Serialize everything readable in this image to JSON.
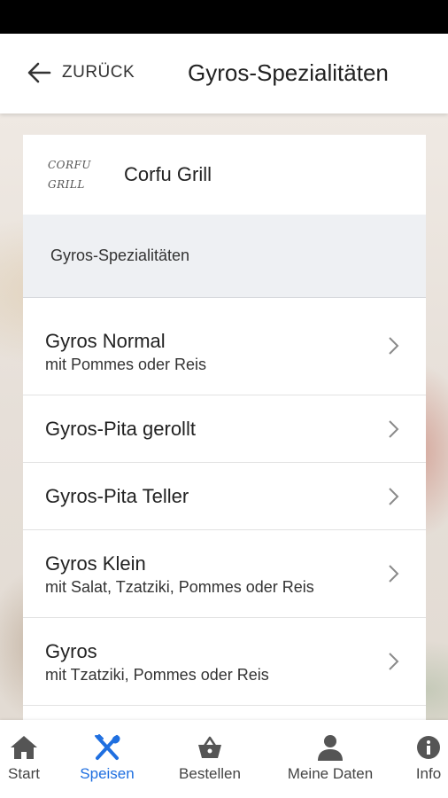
{
  "header": {
    "back_label": "ZURÜCK",
    "title": "Gyros-Spezialitäten"
  },
  "restaurant": {
    "logo_line1": "CORFU",
    "logo_line2": "GRILL",
    "name": "Corfu Grill"
  },
  "category": {
    "label": "Gyros-Spezialitäten"
  },
  "items": [
    {
      "name": "Gyros Normal",
      "sub": "mit Pommes oder Reis"
    },
    {
      "name": "Gyros-Pita gerollt",
      "sub": ""
    },
    {
      "name": "Gyros-Pita Teller",
      "sub": ""
    },
    {
      "name": "Gyros Klein",
      "sub": "mit Salat, Tzatziki, Pommes oder Reis"
    },
    {
      "name": "Gyros",
      "sub": "mit Tzatziki, Pommes oder Reis"
    }
  ],
  "nav": {
    "items": [
      {
        "label": "Start",
        "icon": "home-icon"
      },
      {
        "label": "Speisen",
        "icon": "cutlery-icon",
        "active": true
      },
      {
        "label": "Bestellen",
        "icon": "basket-icon"
      },
      {
        "label": "Meine Daten",
        "icon": "person-icon"
      },
      {
        "label": "Info",
        "icon": "info-icon"
      }
    ]
  },
  "colors": {
    "accent": "#1f6fe0",
    "category_bg": "#eef0f3",
    "status_bar": "#000000"
  }
}
